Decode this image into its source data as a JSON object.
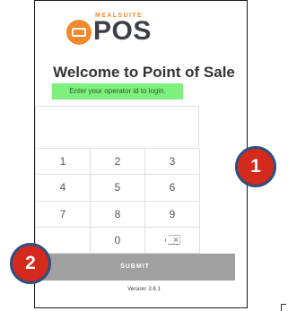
{
  "logo": {
    "brand": "MEALSUITE",
    "product": "POS"
  },
  "title": "Welcome to Point of Sale",
  "hint": "Enter your operator id to login.",
  "input": {
    "value": ""
  },
  "keypad": {
    "keys": [
      "1",
      "2",
      "3",
      "4",
      "5",
      "6",
      "7",
      "8",
      "9",
      "",
      "0"
    ],
    "backspace_icon": "backspace-icon"
  },
  "submit_label": "SUBMIT",
  "version": "Version: 2.6.1",
  "callouts": {
    "one": "1",
    "two": "2"
  },
  "colors": {
    "brand_orange": "#f08a2c",
    "hint_bg": "#7ef07e",
    "submit_bg": "#a0a0a0",
    "callout_red": "#d42a1e",
    "callout_border": "#2f4f80"
  }
}
